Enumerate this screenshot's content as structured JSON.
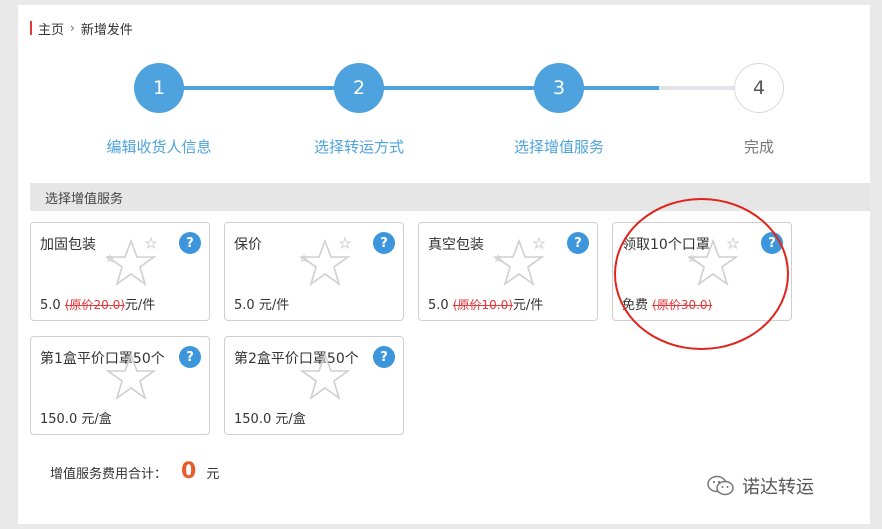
{
  "breadcrumb": {
    "home": "主页",
    "separator": "›",
    "current": "新增发件"
  },
  "steps": [
    {
      "number": "1",
      "label": "编辑收货人信息",
      "active": true
    },
    {
      "number": "2",
      "label": "选择转运方式",
      "active": true
    },
    {
      "number": "3",
      "label": "选择增值服务",
      "active": true
    },
    {
      "number": "4",
      "label": "完成",
      "active": false
    }
  ],
  "section": {
    "title": "选择增值服务"
  },
  "services": [
    {
      "title": "加固包装",
      "price": "5.0",
      "original": "(原价20.0)",
      "unit": "元/件"
    },
    {
      "title": "保价",
      "price": "5.0",
      "original": "",
      "unit": "元/件"
    },
    {
      "title": "真空包装",
      "price": "5.0",
      "original": "(原价10.0)",
      "unit": "元/件"
    },
    {
      "title": "领取10个口罩",
      "price": "免费",
      "original": "(原价30.0)",
      "unit": ""
    },
    {
      "title": "第1盒平价口罩50个",
      "price": "150.0",
      "original": "",
      "unit": "元/盒"
    },
    {
      "title": "第2盒平价口罩50个",
      "price": "150.0",
      "original": "",
      "unit": "元/盒"
    }
  ],
  "help_symbol": "?",
  "total": {
    "label": "增值服务费用合计：",
    "value": "0",
    "unit": "元"
  },
  "watermark": {
    "text": "诺达转运"
  },
  "colors": {
    "accent": "#4ea3de",
    "help": "#3d96dc",
    "strike": "#e4393c",
    "total": "#ea5b2c",
    "annotation": "#e0241b"
  }
}
